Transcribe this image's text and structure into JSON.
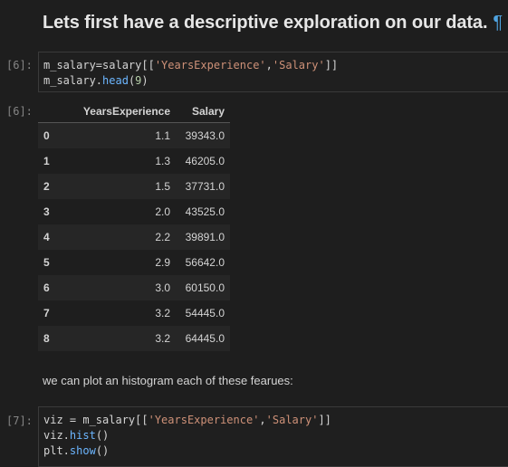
{
  "markdown": {
    "heading": "Lets first have a descriptive exploration on our data.",
    "pilcrow": "¶",
    "paragraph": "we can plot an histogram each of these fearues:"
  },
  "cells": {
    "cell6_in": {
      "prompt": "[6]:",
      "lines": [
        "m_salary=salary[['YearsExperience','Salary']]",
        "m_salary.head(9)"
      ]
    },
    "cell6_out": {
      "prompt": "[6]:",
      "columns": [
        "",
        "YearsExperience",
        "Salary"
      ],
      "rows": [
        [
          "0",
          "1.1",
          "39343.0"
        ],
        [
          "1",
          "1.3",
          "46205.0"
        ],
        [
          "2",
          "1.5",
          "37731.0"
        ],
        [
          "3",
          "2.0",
          "43525.0"
        ],
        [
          "4",
          "2.2",
          "39891.0"
        ],
        [
          "5",
          "2.9",
          "56642.0"
        ],
        [
          "6",
          "3.0",
          "60150.0"
        ],
        [
          "7",
          "3.2",
          "54445.0"
        ],
        [
          "8",
          "3.2",
          "64445.0"
        ]
      ]
    },
    "cell7_in": {
      "prompt": "[7]:",
      "lines": [
        "viz = m_salary[['YearsExperience','Salary']]",
        "viz.hist()",
        "plt.show()"
      ]
    }
  },
  "colors": {
    "background": "#1e1e1e",
    "string": "#ce9178",
    "function": "#6cb6ff",
    "number": "#b5cea8",
    "pilcrow": "#4fa3e0"
  }
}
